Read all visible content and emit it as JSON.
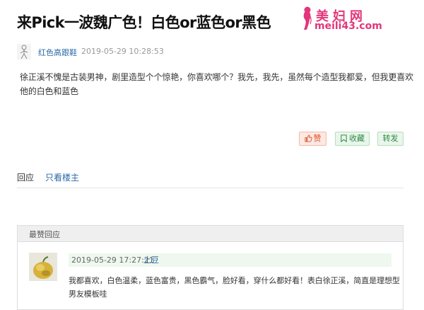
{
  "post": {
    "title": "来Pick一波魏广色！白色or蓝色or黑色",
    "author": "红色高跟鞋",
    "timestamp": "2019-05-29 10:28:53",
    "content": "徐正溪不愧是古装男神，剧里造型个个惊艳，你喜欢哪个？我先，我先，虽然每个造型我都爱，但我更喜欢他的白色和蓝色"
  },
  "logo": {
    "name": "美妇网",
    "url": "meili43.com"
  },
  "actions": {
    "like_label": "赞",
    "favorite_label": "收藏",
    "share_label": "转发"
  },
  "tabs": {
    "reply": "回应",
    "owner_only": "只看楼主"
  },
  "best_replies": {
    "header": "最赞回应",
    "items": [
      {
        "timestamp": "2019-05-29 17:27:21",
        "user": "土豆",
        "text": "我都喜欢，白色温柔，蓝色富贵，黑色霸气，脸好看，穿什么都好看！表白徐正溪，简直是理想型男友模板哇"
      }
    ]
  },
  "colors": {
    "link": "#2b6aa8",
    "logo": "#e2367a",
    "like": "#d9532a",
    "favorite": "#2f8a44"
  },
  "icons": {
    "like": "thumbs-up-icon",
    "favorite": "bookmark-icon"
  }
}
